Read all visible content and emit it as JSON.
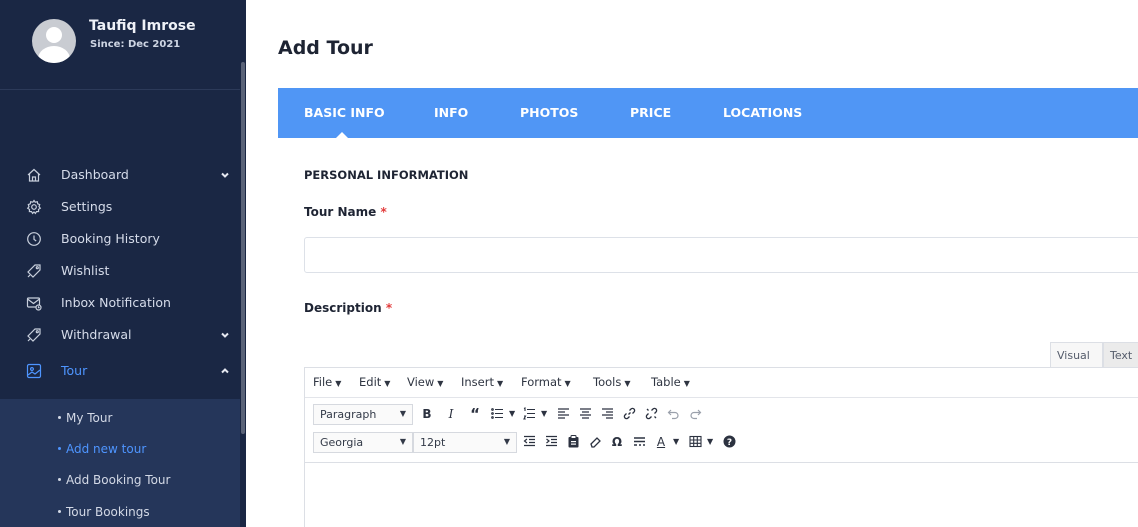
{
  "user": {
    "name": "Taufiq Imrose",
    "since": "Since: Dec 2021"
  },
  "sidebar": {
    "items": [
      {
        "label": "Dashboard",
        "icon": "home-icon",
        "chevron": "down"
      },
      {
        "label": "Settings",
        "icon": "gear-icon"
      },
      {
        "label": "Booking History",
        "icon": "clock-icon"
      },
      {
        "label": "Wishlist",
        "icon": "tag-icon"
      },
      {
        "label": "Inbox Notification",
        "icon": "mail-icon"
      },
      {
        "label": "Withdrawal",
        "icon": "tag-icon",
        "chevron": "down"
      },
      {
        "label": "Tour",
        "icon": "image-icon",
        "chevron": "up",
        "active": true
      }
    ],
    "submenu": [
      {
        "label": "My Tour"
      },
      {
        "label": "Add new tour",
        "active": true
      },
      {
        "label": "Add Booking Tour"
      },
      {
        "label": "Tour Bookings"
      }
    ]
  },
  "page": {
    "title": "Add Tour"
  },
  "tabs": [
    {
      "label": "BASIC INFO",
      "active": true
    },
    {
      "label": "INFO"
    },
    {
      "label": "PHOTOS"
    },
    {
      "label": "PRICE"
    },
    {
      "label": "LOCATIONS"
    }
  ],
  "form": {
    "section_title": "PERSONAL INFORMATION",
    "tour_name_label": "Tour Name",
    "tour_name_value": "",
    "description_label": "Description",
    "required_mark": "*"
  },
  "editor": {
    "mode_tabs": {
      "visual": "Visual",
      "text": "Text"
    },
    "menus": [
      "File",
      "Edit",
      "View",
      "Insert",
      "Format",
      "Tools",
      "Table"
    ],
    "format_select": "Paragraph",
    "font_select": "Georgia",
    "size_select": "12pt",
    "buttons": {
      "bold": "B",
      "italic": "I",
      "blockquote": "“",
      "special_char": "Ω",
      "text_color": "A",
      "help": "?"
    }
  },
  "colors": {
    "sidebar_bg": "#1a2744",
    "submenu_bg": "#25365a",
    "accent": "#5096f5",
    "active_link": "#4e95ff",
    "required": "#e23b3b"
  }
}
